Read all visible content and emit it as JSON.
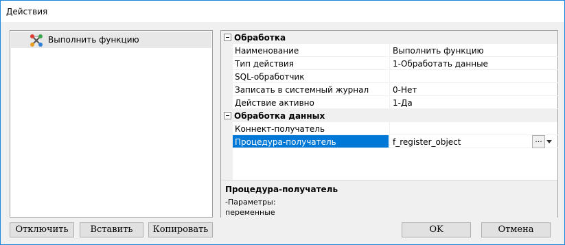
{
  "window": {
    "title": "Действия"
  },
  "tree": {
    "items": [
      {
        "label": "Выполнить функцию",
        "icon": "function-icon"
      }
    ]
  },
  "properties": {
    "categories": [
      {
        "label": "Обработка",
        "rows": [
          {
            "name": "Наименование",
            "value": "Выполнить функцию"
          },
          {
            "name": "Тип действия",
            "value": "1-Обработать данные"
          },
          {
            "name": "SQL-обработчик",
            "value": ""
          },
          {
            "name": "Записать в системный журнал",
            "value": "0-Нет"
          },
          {
            "name": "Действие активно",
            "value": "1-Да"
          }
        ]
      },
      {
        "label": "Обработка данных",
        "rows": [
          {
            "name": "Коннект-получатель",
            "value": ""
          },
          {
            "name": "Процедура-получатель",
            "value": "f_register_object",
            "selected": true
          }
        ]
      }
    ],
    "ellipsis_label": "...",
    "description": {
      "title": "Процедура-получатель",
      "text": "-Параметры:\nпеременные"
    }
  },
  "buttons": {
    "disable": "Отключить",
    "paste": "Вставить",
    "copy": "Копировать",
    "ok": "OK",
    "cancel": "Отмена"
  },
  "colors": {
    "selection": "#0078d7",
    "window_border": "#1883d7"
  }
}
